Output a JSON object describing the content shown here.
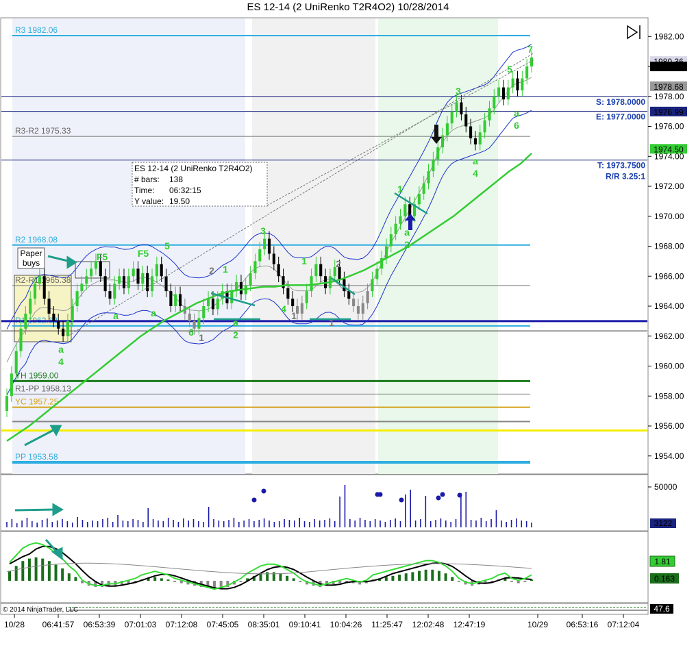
{
  "title": "ES 12-14 (2 UniRenko T2R4O2)  10/28/2014",
  "colors": {
    "up_bar": "#33cc33",
    "down_bar": "#000000",
    "neutral_bar": "#888888",
    "pivot_line": "#2eaee0",
    "level_line": "#1a237e",
    "yh_line": "#1b7a1b",
    "yc_line": "#d4a017",
    "yellow_line": "#f5ee00",
    "ema": "#33cc33",
    "volume": "#1a1aaa",
    "macd_up": "#1b6e1b",
    "macd_down": "#888888"
  },
  "price_axis": {
    "ticks": [
      "1982.00",
      "1980.00",
      "1978.00",
      "1976.00",
      "1974.00",
      "1972.00",
      "1970.00",
      "1968.00",
      "1966.00",
      "1964.00",
      "1962.00",
      "1960.00",
      "1958.00",
      "1956.00",
      "1954.00"
    ],
    "badges": [
      {
        "label": "1980.36",
        "value": 1980.36,
        "style": "light"
      },
      {
        "label": "1980.00",
        "value": 1980.0,
        "style": "dark"
      },
      {
        "label": "1978.68",
        "value": 1978.68,
        "style": "gray"
      },
      {
        "label": "1976.99",
        "value": 1976.99,
        "style": "navy"
      },
      {
        "label": "1974.50",
        "value": 1974.5,
        "style": "green"
      }
    ]
  },
  "volume_axis": {
    "tick": "50000",
    "badge": "3122"
  },
  "macd_axis": {
    "badge_a": "1.81",
    "badge_b": "0.163"
  },
  "footer": {
    "copyright": "© 2014 NinjaTrader, LLC",
    "badge": "47.6"
  },
  "time_axis": [
    "10/28",
    "06:41:57",
    "06:53:39",
    "07:01:03",
    "07:12:08",
    "07:45:05",
    "08:35:01",
    "09:10:41",
    "10:04:26",
    "11:25:47",
    "12:02:48",
    "12:47:19",
    "10/29",
    "06:53:16",
    "07:12:04"
  ],
  "levels": [
    {
      "label": "R3 1982.06",
      "value": 1982.06,
      "kind": "pivot"
    },
    {
      "label": "R3-R2 1975.33",
      "value": 1975.33,
      "kind": "gray"
    },
    {
      "label": "R2 1968.08",
      "value": 1968.08,
      "kind": "pivot"
    },
    {
      "label": "R2-R1 1965.38",
      "value": 1965.38,
      "kind": "gray"
    },
    {
      "label": "R1 1962.68",
      "value": 1962.68,
      "kind": "pivot"
    },
    {
      "label": "YH 1959.00",
      "value": 1959.0,
      "kind": "yh"
    },
    {
      "label": "R1-PP 1958.13",
      "value": 1958.13,
      "kind": "gray"
    },
    {
      "label": "YC 1957.25",
      "value": 1957.25,
      "kind": "yc"
    },
    {
      "label": "PP 1953.58",
      "value": 1953.58,
      "kind": "pivot"
    }
  ],
  "order_lines": [
    {
      "label": "S: 1978.0000",
      "value": 1978.0
    },
    {
      "label": "E: 1977.0000",
      "value": 1977.0
    },
    {
      "label": "T: 1973.7500",
      "value": 1973.75,
      "extra": "R/R 3.25:1"
    }
  ],
  "info_box": {
    "line1": "ES 12-14 (2 UniRenko T2R4O2)",
    "bars_label": "# bars:",
    "bars_value": "138",
    "time_label": "Time:",
    "time_value": "06:32:15",
    "y_label": "Y value:",
    "y_value": "19.50"
  },
  "paper_buys": {
    "line1": "Paper",
    "line2": "buys"
  },
  "annotations": [
    {
      "t": "a",
      "x": 89,
      "y": 515
    },
    {
      "t": "4",
      "x": 89,
      "y": 533
    },
    {
      "t": "F5",
      "x": 149,
      "y": 380
    },
    {
      "t": "F5",
      "x": 209,
      "y": 375
    },
    {
      "t": "5",
      "x": 244,
      "y": 364
    },
    {
      "t": "a",
      "x": 169,
      "y": 466
    },
    {
      "t": "a",
      "x": 224,
      "y": 462
    },
    {
      "t": "6",
      "x": 279,
      "y": 490
    },
    {
      "t": "1",
      "x": 329,
      "y": 398
    },
    {
      "t": "a",
      "x": 344,
      "y": 476
    },
    {
      "t": "2",
      "x": 344,
      "y": 494
    },
    {
      "t": "3",
      "x": 384,
      "y": 342
    },
    {
      "t": "4",
      "x": 414,
      "y": 456
    },
    {
      "t": "1",
      "x": 444,
      "y": 386
    },
    {
      "t": "1",
      "x": 584,
      "y": 281
    },
    {
      "t": "a",
      "x": 594,
      "y": 344
    },
    {
      "t": "2",
      "x": 594,
      "y": 362
    },
    {
      "t": "3",
      "x": 669,
      "y": 138
    },
    {
      "t": "a",
      "x": 694,
      "y": 240
    },
    {
      "t": "4",
      "x": 694,
      "y": 258
    },
    {
      "t": "5",
      "x": 744,
      "y": 106
    },
    {
      "t": "7",
      "x": 774,
      "y": 77
    },
    {
      "t": "a",
      "x": 754,
      "y": 170
    },
    {
      "t": "6",
      "x": 754,
      "y": 188
    }
  ],
  "gray_annotations": [
    {
      "t": "2",
      "x": 309,
      "y": 400
    },
    {
      "t": "1",
      "x": 294,
      "y": 498
    },
    {
      "t": "1",
      "x": 429,
      "y": 466
    },
    {
      "t": "2",
      "x": 494,
      "y": 390
    },
    {
      "t": "1",
      "x": 484,
      "y": 476
    }
  ],
  "chart_data": {
    "type": "candlestick",
    "title": "ES 12-14 (2 UniRenko T2R4O2)  10/28/2014",
    "ylim": [
      1952.8,
      1983.2
    ],
    "y_ticks": [
      1982,
      1980,
      1978,
      1976,
      1974,
      1972,
      1970,
      1968,
      1966,
      1964,
      1962,
      1960,
      1958,
      1956,
      1954
    ],
    "grid": false,
    "bars": [
      {
        "o": 1957,
        "c": 1958,
        "d": "u"
      },
      {
        "o": 1958,
        "c": 1959.5,
        "d": "u"
      },
      {
        "o": 1959.5,
        "c": 1961,
        "d": "u"
      },
      {
        "o": 1961,
        "c": 1962.5,
        "d": "u"
      },
      {
        "o": 1962.5,
        "c": 1963.5,
        "d": "u"
      },
      {
        "o": 1963.5,
        "c": 1964.5,
        "d": "u"
      },
      {
        "o": 1964.5,
        "c": 1965.5,
        "d": "u"
      },
      {
        "o": 1965.5,
        "c": 1966,
        "d": "u"
      },
      {
        "o": 1966,
        "c": 1964.5,
        "d": "d"
      },
      {
        "o": 1964.5,
        "c": 1963.5,
        "d": "d"
      },
      {
        "o": 1963.5,
        "c": 1963,
        "d": "d"
      },
      {
        "o": 1963,
        "c": 1962.5,
        "d": "d"
      },
      {
        "o": 1962.5,
        "c": 1962,
        "d": "d"
      },
      {
        "o": 1962,
        "c": 1963,
        "d": "u"
      },
      {
        "o": 1963,
        "c": 1964,
        "d": "u"
      },
      {
        "o": 1964,
        "c": 1965,
        "d": "u"
      },
      {
        "o": 1965,
        "c": 1965.5,
        "d": "u"
      },
      {
        "o": 1965.5,
        "c": 1966,
        "d": "u"
      },
      {
        "o": 1966,
        "c": 1966.5,
        "d": "u"
      },
      {
        "o": 1966.5,
        "c": 1967,
        "d": "u"
      },
      {
        "o": 1967,
        "c": 1966,
        "d": "d"
      },
      {
        "o": 1966,
        "c": 1965,
        "d": "d"
      },
      {
        "o": 1965,
        "c": 1964.5,
        "d": "d"
      },
      {
        "o": 1964.5,
        "c": 1965.5,
        "d": "u"
      },
      {
        "o": 1965.5,
        "c": 1966,
        "d": "u"
      },
      {
        "o": 1966,
        "c": 1965.2,
        "d": "d"
      },
      {
        "o": 1965.2,
        "c": 1966,
        "d": "u"
      },
      {
        "o": 1966,
        "c": 1966.5,
        "d": "u"
      },
      {
        "o": 1966.5,
        "c": 1965.5,
        "d": "d"
      },
      {
        "o": 1965.5,
        "c": 1966.2,
        "d": "u"
      },
      {
        "o": 1966.2,
        "c": 1965,
        "d": "d"
      },
      {
        "o": 1965,
        "c": 1966,
        "d": "u"
      },
      {
        "o": 1966,
        "c": 1966.8,
        "d": "u"
      },
      {
        "o": 1966.8,
        "c": 1966,
        "d": "d"
      },
      {
        "o": 1966,
        "c": 1965,
        "d": "d"
      },
      {
        "o": 1965,
        "c": 1964,
        "d": "d"
      },
      {
        "o": 1964,
        "c": 1964.8,
        "d": "u"
      },
      {
        "o": 1964.8,
        "c": 1964,
        "d": "d"
      },
      {
        "o": 1964,
        "c": 1963.5,
        "d": "n"
      },
      {
        "o": 1963.5,
        "c": 1963,
        "d": "n"
      },
      {
        "o": 1963,
        "c": 1962.5,
        "d": "n"
      },
      {
        "o": 1962.5,
        "c": 1963.2,
        "d": "u"
      },
      {
        "o": 1963.2,
        "c": 1964,
        "d": "u"
      },
      {
        "o": 1964,
        "c": 1964.5,
        "d": "u"
      },
      {
        "o": 1964.5,
        "c": 1963.8,
        "d": "d"
      },
      {
        "o": 1963.8,
        "c": 1964.5,
        "d": "u"
      },
      {
        "o": 1964.5,
        "c": 1965,
        "d": "u"
      },
      {
        "o": 1965,
        "c": 1964.2,
        "d": "d"
      },
      {
        "o": 1964.2,
        "c": 1965,
        "d": "u"
      },
      {
        "o": 1965,
        "c": 1965.6,
        "d": "u"
      },
      {
        "o": 1965.6,
        "c": 1964.8,
        "d": "d"
      },
      {
        "o": 1964.8,
        "c": 1965.4,
        "d": "u"
      },
      {
        "o": 1965.4,
        "c": 1966.2,
        "d": "u"
      },
      {
        "o": 1966.2,
        "c": 1967,
        "d": "u"
      },
      {
        "o": 1967,
        "c": 1967.8,
        "d": "u"
      },
      {
        "o": 1967.8,
        "c": 1968.5,
        "d": "u"
      },
      {
        "o": 1968.5,
        "c": 1967.5,
        "d": "d"
      },
      {
        "o": 1967.5,
        "c": 1966.8,
        "d": "d"
      },
      {
        "o": 1966.8,
        "c": 1966,
        "d": "d"
      },
      {
        "o": 1966,
        "c": 1965.2,
        "d": "d"
      },
      {
        "o": 1965.2,
        "c": 1964.5,
        "d": "d"
      },
      {
        "o": 1964.5,
        "c": 1964,
        "d": "d"
      },
      {
        "o": 1964,
        "c": 1963.5,
        "d": "n"
      },
      {
        "o": 1963.5,
        "c": 1964.2,
        "d": "n"
      },
      {
        "o": 1964.2,
        "c": 1965,
        "d": "u"
      },
      {
        "o": 1965,
        "c": 1966,
        "d": "u"
      },
      {
        "o": 1966,
        "c": 1966.8,
        "d": "u"
      },
      {
        "o": 1966.8,
        "c": 1966,
        "d": "d"
      },
      {
        "o": 1966,
        "c": 1965.2,
        "d": "d"
      },
      {
        "o": 1965.2,
        "c": 1966,
        "d": "u"
      },
      {
        "o": 1966,
        "c": 1966.6,
        "d": "u"
      },
      {
        "o": 1966.6,
        "c": 1965.8,
        "d": "d"
      },
      {
        "o": 1965.8,
        "c": 1965,
        "d": "d"
      },
      {
        "o": 1965,
        "c": 1964.5,
        "d": "d"
      },
      {
        "o": 1964.5,
        "c": 1964,
        "d": "n"
      },
      {
        "o": 1964,
        "c": 1963.5,
        "d": "n"
      },
      {
        "o": 1963.5,
        "c": 1964.2,
        "d": "n"
      },
      {
        "o": 1964.2,
        "c": 1965,
        "d": "n"
      },
      {
        "o": 1965,
        "c": 1965.8,
        "d": "u"
      },
      {
        "o": 1965.8,
        "c": 1966.5,
        "d": "u"
      },
      {
        "o": 1966.5,
        "c": 1967.2,
        "d": "u"
      },
      {
        "o": 1967.2,
        "c": 1968,
        "d": "u"
      },
      {
        "o": 1968,
        "c": 1968.8,
        "d": "u"
      },
      {
        "o": 1968.8,
        "c": 1969.5,
        "d": "u"
      },
      {
        "o": 1969.5,
        "c": 1970,
        "d": "u"
      },
      {
        "o": 1970,
        "c": 1970.8,
        "d": "u"
      },
      {
        "o": 1970.8,
        "c": 1970,
        "d": "d"
      },
      {
        "o": 1970,
        "c": 1970.8,
        "d": "u"
      },
      {
        "o": 1970.8,
        "c": 1971.5,
        "d": "u"
      },
      {
        "o": 1971.5,
        "c": 1972.2,
        "d": "u"
      },
      {
        "o": 1972.2,
        "c": 1973,
        "d": "u"
      },
      {
        "o": 1973,
        "c": 1973.8,
        "d": "u"
      },
      {
        "o": 1973.8,
        "c": 1974.6,
        "d": "u"
      },
      {
        "o": 1974.6,
        "c": 1975.4,
        "d": "u"
      },
      {
        "o": 1975.4,
        "c": 1976.2,
        "d": "u"
      },
      {
        "o": 1976.2,
        "c": 1977,
        "d": "u"
      },
      {
        "o": 1977,
        "c": 1977.6,
        "d": "u"
      },
      {
        "o": 1977.6,
        "c": 1976.8,
        "d": "d"
      },
      {
        "o": 1976.8,
        "c": 1976,
        "d": "d"
      },
      {
        "o": 1976,
        "c": 1975.2,
        "d": "d"
      },
      {
        "o": 1975.2,
        "c": 1974.8,
        "d": "d"
      },
      {
        "o": 1974.8,
        "c": 1975.6,
        "d": "u"
      },
      {
        "o": 1975.6,
        "c": 1976.4,
        "d": "u"
      },
      {
        "o": 1976.4,
        "c": 1977.2,
        "d": "u"
      },
      {
        "o": 1977.2,
        "c": 1978,
        "d": "u"
      },
      {
        "o": 1978,
        "c": 1978.6,
        "d": "u"
      },
      {
        "o": 1978.6,
        "c": 1977.8,
        "d": "d"
      },
      {
        "o": 1977.8,
        "c": 1978.6,
        "d": "u"
      },
      {
        "o": 1978.6,
        "c": 1979.2,
        "d": "u"
      },
      {
        "o": 1979.2,
        "c": 1978.4,
        "d": "d"
      },
      {
        "o": 1978.4,
        "c": 1979.2,
        "d": "u"
      },
      {
        "o": 1979.2,
        "c": 1980,
        "d": "u"
      },
      {
        "o": 1980,
        "c": 1980.6,
        "d": "u"
      }
    ],
    "ema_line": [
      1955,
      1955.5,
      1956,
      1956.6,
      1957.2,
      1957.8,
      1958.4,
      1959,
      1959.6,
      1960.2,
      1960.8,
      1961.4,
      1962,
      1962.5,
      1963,
      1963.4,
      1963.8,
      1964.2,
      1964.5,
      1964.8,
      1965,
      1965.1,
      1965.2,
      1965.3,
      1965.3,
      1965.4,
      1965.4,
      1965.4,
      1965.5,
      1965.6,
      1965.8,
      1966.1,
      1966.4,
      1966.8,
      1967.2,
      1967.6,
      1968,
      1968.5,
      1969,
      1969.5,
      1970,
      1970.6,
      1971.2,
      1971.8,
      1972.4,
      1973,
      1973.5,
      1974.2
    ],
    "volume_bars": [
      8,
      12,
      6,
      10,
      14,
      9,
      7,
      11,
      13,
      8,
      10,
      12,
      9,
      7,
      15,
      11,
      8,
      10,
      9,
      12,
      14,
      8,
      18,
      10,
      9,
      12,
      11,
      8,
      28,
      12,
      10,
      9,
      14,
      11,
      8,
      13,
      10,
      12,
      9,
      8,
      30,
      12,
      10,
      9,
      11,
      14,
      8,
      10,
      12,
      9,
      11,
      13,
      10,
      8,
      9,
      12,
      11,
      10,
      14,
      9,
      8,
      12,
      10,
      11,
      13,
      9,
      45,
      62,
      12,
      10,
      14,
      11,
      9,
      12,
      10,
      8,
      11,
      13,
      9,
      48,
      55,
      10,
      12,
      46,
      9,
      11,
      13,
      10,
      8,
      12,
      50,
      52,
      11,
      10,
      14,
      9,
      12,
      25,
      10,
      8,
      11,
      13,
      10,
      9,
      7
    ],
    "volume_dots": [
      40,
      53,
      48,
      48,
      40,
      43,
      48,
      47
    ],
    "macd_hist": [
      8,
      12,
      16,
      18,
      19,
      18,
      16,
      13,
      10,
      6,
      3,
      -2,
      -4,
      -5,
      -5,
      -4,
      -4,
      -3,
      -2,
      -1,
      1,
      2,
      3,
      2,
      1,
      -1,
      -2,
      -3,
      -4,
      -5,
      -6,
      -7,
      -6,
      -5,
      -3,
      -1,
      2,
      4,
      6,
      7,
      7,
      6,
      4,
      2,
      -1,
      -3,
      -4,
      -5,
      -4,
      -3,
      -2,
      -1,
      -2,
      -3,
      -2,
      1,
      2,
      3,
      4,
      5,
      6,
      7,
      8,
      9,
      9,
      8,
      6,
      3,
      -1,
      -3,
      -4,
      -3,
      -2,
      -1,
      1,
      2,
      -1,
      -2,
      -1,
      1
    ]
  }
}
